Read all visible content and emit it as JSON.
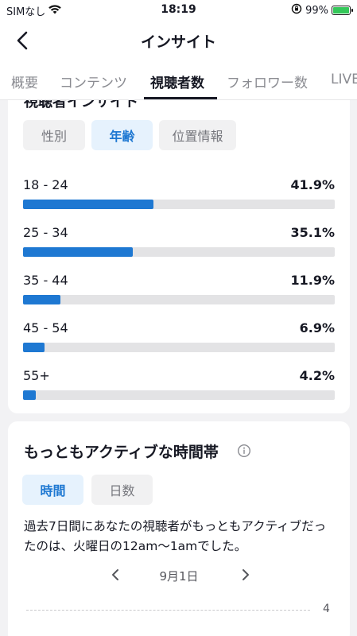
{
  "status_bar": {
    "carrier": "SIMなし",
    "time": "18:19",
    "battery": "99%",
    "wifi_icon": "wifi-icon",
    "orientation_icon": "orientation-lock-icon"
  },
  "header": {
    "title": "インサイト",
    "back_icon": "chevron-left-icon"
  },
  "tabs": [
    {
      "label": "概要",
      "active": false
    },
    {
      "label": "コンテンツ",
      "active": false
    },
    {
      "label": "視聴者数",
      "active": true
    },
    {
      "label": "フォロワー数",
      "active": false
    },
    {
      "label": "LIVE",
      "active": false
    }
  ],
  "audience_card": {
    "partial_title": "視聴者インサイト",
    "filters": [
      {
        "label": "性別",
        "active": false
      },
      {
        "label": "年齢",
        "active": true
      },
      {
        "label": "位置情報",
        "active": false
      }
    ],
    "age_groups": [
      {
        "label": "18 - 24",
        "value": "41.9%",
        "percent": 41.9
      },
      {
        "label": "25 - 34",
        "value": "35.1%",
        "percent": 35.1
      },
      {
        "label": "35 - 44",
        "value": "11.9%",
        "percent": 11.9
      },
      {
        "label": "45 - 54",
        "value": "6.9%",
        "percent": 6.9
      },
      {
        "label": "55+",
        "value": "4.2%",
        "percent": 4.2
      }
    ],
    "accent_color": "#1e78d2"
  },
  "active_card": {
    "title": "もっともアクティブな時間帯",
    "info_icon": "info-icon",
    "toggles": [
      {
        "label": "時間",
        "active": true
      },
      {
        "label": "日数",
        "active": false
      }
    ],
    "description": "過去7日間にあなたの視聴者がもっともアクティブだったのは、火曜日の12am〜1amでした。",
    "date": "9月1日",
    "prev_icon": "chevron-left-icon",
    "next_icon": "chevron-right-icon",
    "y_tick": "4"
  }
}
